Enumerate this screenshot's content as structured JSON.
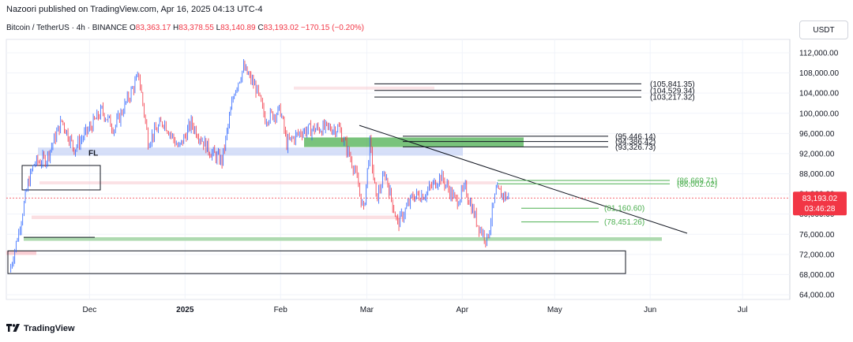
{
  "header": {
    "published": "Nazoori published on TradingView.com, Apr 16, 2025 04:13 UTC-4"
  },
  "symbol": {
    "title": "Bitcoin / TetherUS · 4h · BINANCE",
    "o_label": "O",
    "o_value": "83,363.17",
    "h_label": "H",
    "h_value": "83,378.55",
    "l_label": "L",
    "l_value": "83,140.89",
    "c_label": "C",
    "c_value": "83,193.02",
    "change": "−170.15 (−0.20%)"
  },
  "currency": "USDT",
  "brand": "TradingView",
  "colors": {
    "up": "#2962ff",
    "down": "#f23645",
    "green_zone": "#4caf50",
    "blue_zone": "#c5d1f5",
    "pink_zone": "#f8c9cf",
    "price_tag": "#f23645"
  },
  "chart_data": {
    "type": "line",
    "title": "Bitcoin / TetherUS · 4h · BINANCE",
    "xlabel": "",
    "ylabel": "",
    "ylim": [
      62000,
      116000
    ],
    "x_ticks": [
      "Dec",
      "2025",
      "Feb",
      "Mar",
      "Apr",
      "May",
      "Jun",
      "Jul"
    ],
    "y_ticks": [
      "112,000.00",
      "108,000.00",
      "104,000.00",
      "100,000.00",
      "96,000.00",
      "92,000.00",
      "88,000.00",
      "84,000.00",
      "80,000.00",
      "76,000.00",
      "72,000.00",
      "68,000.00",
      "64,000.00"
    ],
    "current_price": "83,193.02",
    "countdown": "03:46:28",
    "series": [
      {
        "x": [
          "2024-11-05",
          "2024-11-08",
          "2024-11-11",
          "2024-11-13",
          "2024-11-17",
          "2024-11-22",
          "2024-11-26",
          "2024-12-01",
          "2024-12-05",
          "2024-12-09",
          "2024-12-12",
          "2024-12-17",
          "2024-12-20",
          "2024-12-25",
          "2024-12-30",
          "2025-01-03",
          "2025-01-09",
          "2025-01-13",
          "2025-01-17",
          "2025-01-20",
          "2025-01-24",
          "2025-01-27",
          "2025-02-01",
          "2025-02-03",
          "2025-02-08",
          "2025-02-14",
          "2025-02-20",
          "2025-02-25",
          "2025-02-28",
          "2025-03-02",
          "2025-03-04",
          "2025-03-07",
          "2025-03-11",
          "2025-03-16",
          "2025-03-20",
          "2025-03-25",
          "2025-03-30",
          "2025-04-02",
          "2025-04-06",
          "2025-04-09",
          "2025-04-12",
          "2025-04-16"
        ],
        "values": [
          68500,
          76500,
          86000,
          90000,
          91000,
          98500,
          93000,
          97000,
          100500,
          97000,
          101000,
          107500,
          94500,
          98500,
          93000,
          98000,
          92500,
          90500,
          104500,
          109000,
          105000,
          99000,
          100500,
          94000,
          96500,
          97000,
          97000,
          89000,
          80500,
          94000,
          83000,
          88000,
          78000,
          83500,
          84000,
          87500,
          82500,
          85000,
          78000,
          74800,
          84500,
          83193
        ]
      }
    ],
    "annotations": {
      "line_labels": [
        "(105,841.35)",
        "(104,529.34)",
        "(103,217.32)",
        "(95,446.14)",
        "(94,386.42)",
        "(93,326.73)",
        "(86,669.71)",
        "(86,002.02)",
        "(81,160.60)",
        "(78,451.26)"
      ],
      "marker": "FL"
    }
  }
}
